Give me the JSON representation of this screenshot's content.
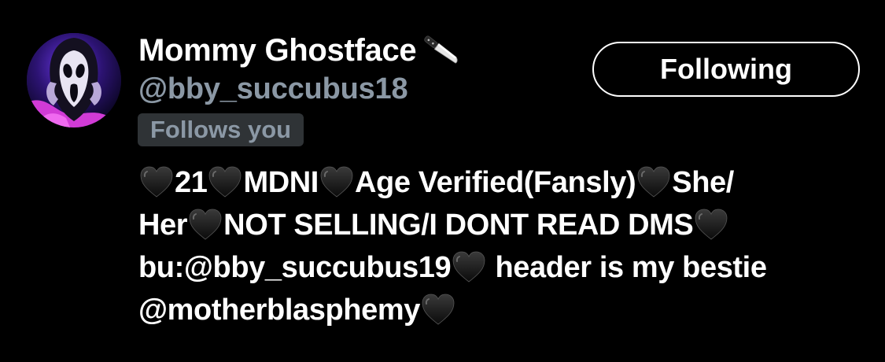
{
  "profile": {
    "display_name": "Mommy Ghostface",
    "name_emoji": "kitchen-knife-icon",
    "handle": "@bby_succubus18",
    "follows_you_label": "Follows you",
    "following_button_label": "Following",
    "avatar": "avatar-image"
  },
  "bio": {
    "heart_icon": "black-heart-icon",
    "seg1": "21",
    "seg2": "MDNI",
    "seg3": "Age Verified(Fansly)",
    "seg4": "She/",
    "seg5": "Her",
    "seg6": "NOT SELLING/I DONT READ DMS",
    "seg7": "bu:@bby_succubus19",
    "seg8": "header is my bestie",
    "seg9": "@motherblasphemy"
  },
  "colors": {
    "background": "#000000",
    "primary_text": "#ffffff",
    "secondary_text": "#8b98a5",
    "badge_background": "#2f3336",
    "button_border": "#ffffff"
  }
}
